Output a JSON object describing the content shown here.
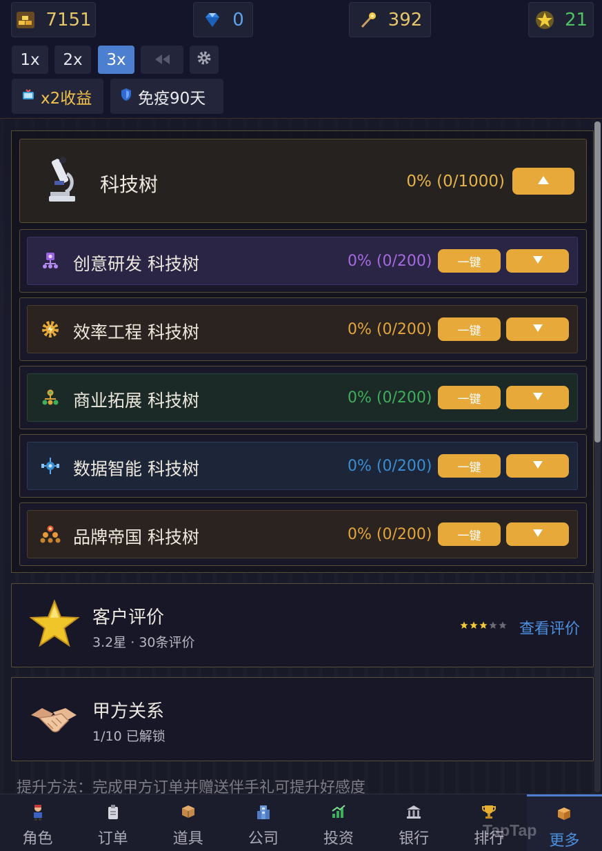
{
  "resources": {
    "gold": {
      "icon": "gold-bars-icon",
      "value": "7151",
      "color": "#e7c66a"
    },
    "diamond": {
      "icon": "diamond-icon",
      "value": "0",
      "color": "#5ea2ec"
    },
    "wand": {
      "icon": "wand-icon",
      "value": "392",
      "color": "#e7c66a"
    },
    "star": {
      "icon": "star-coin-icon",
      "value": "21",
      "color": "#4fc262"
    }
  },
  "speed": {
    "x1": "1x",
    "x2": "2x",
    "x3": "3x",
    "active": "3x"
  },
  "chips": {
    "income": "x2收益",
    "immune": "免疫90天"
  },
  "tech": {
    "title": "科技树",
    "progress": "0% (0/1000)",
    "branches": [
      {
        "name": "创意研发 科技树",
        "progress": "0% (0/200)",
        "color": "#a66ae0",
        "bg": "#2a2445",
        "border": "#3d3466",
        "icon": "network-icon"
      },
      {
        "name": "效率工程 科技树",
        "progress": "0% (0/200)",
        "color": "#e3a53c",
        "bg": "#2a231f",
        "border": "#4a3d2a",
        "icon": "gear-icon"
      },
      {
        "name": "商业拓展 科技树",
        "progress": "0% (0/200)",
        "color": "#3fae5a",
        "bg": "#1b2a27",
        "border": "#2a4339",
        "icon": "tree-icon"
      },
      {
        "name": "数据智能 科技树",
        "progress": "0% (0/200)",
        "color": "#3a8ed4",
        "bg": "#1d2538",
        "border": "#2b3a58",
        "icon": "data-node-icon"
      },
      {
        "name": "品牌帝国 科技树",
        "progress": "0% (0/200)",
        "color": "#e3a53c",
        "bg": "#2a231f",
        "border": "#4a3d2a",
        "icon": "pyramid-icon"
      }
    ],
    "onekey_label": "一键"
  },
  "reviews": {
    "title": "客户评价",
    "subtitle": "3.2星 · 30条评价",
    "stars_filled": 3,
    "stars_total": 5,
    "link": "查看评价"
  },
  "clients": {
    "title": "甲方关系",
    "subtitle": "1/10 已解锁"
  },
  "hint": "提升方法：完成甲方订单并赠送伴手礼可提升好感度",
  "nav": [
    {
      "label": "角色",
      "icon": "character-icon"
    },
    {
      "label": "订单",
      "icon": "clipboard-icon"
    },
    {
      "label": "道具",
      "icon": "box-icon"
    },
    {
      "label": "公司",
      "icon": "building-icon"
    },
    {
      "label": "投资",
      "icon": "chart-up-icon"
    },
    {
      "label": "银行",
      "icon": "bank-icon"
    },
    {
      "label": "排行",
      "icon": "trophy-icon"
    },
    {
      "label": "更多",
      "icon": "package-icon",
      "active": true
    }
  ],
  "watermark": "TapTap"
}
